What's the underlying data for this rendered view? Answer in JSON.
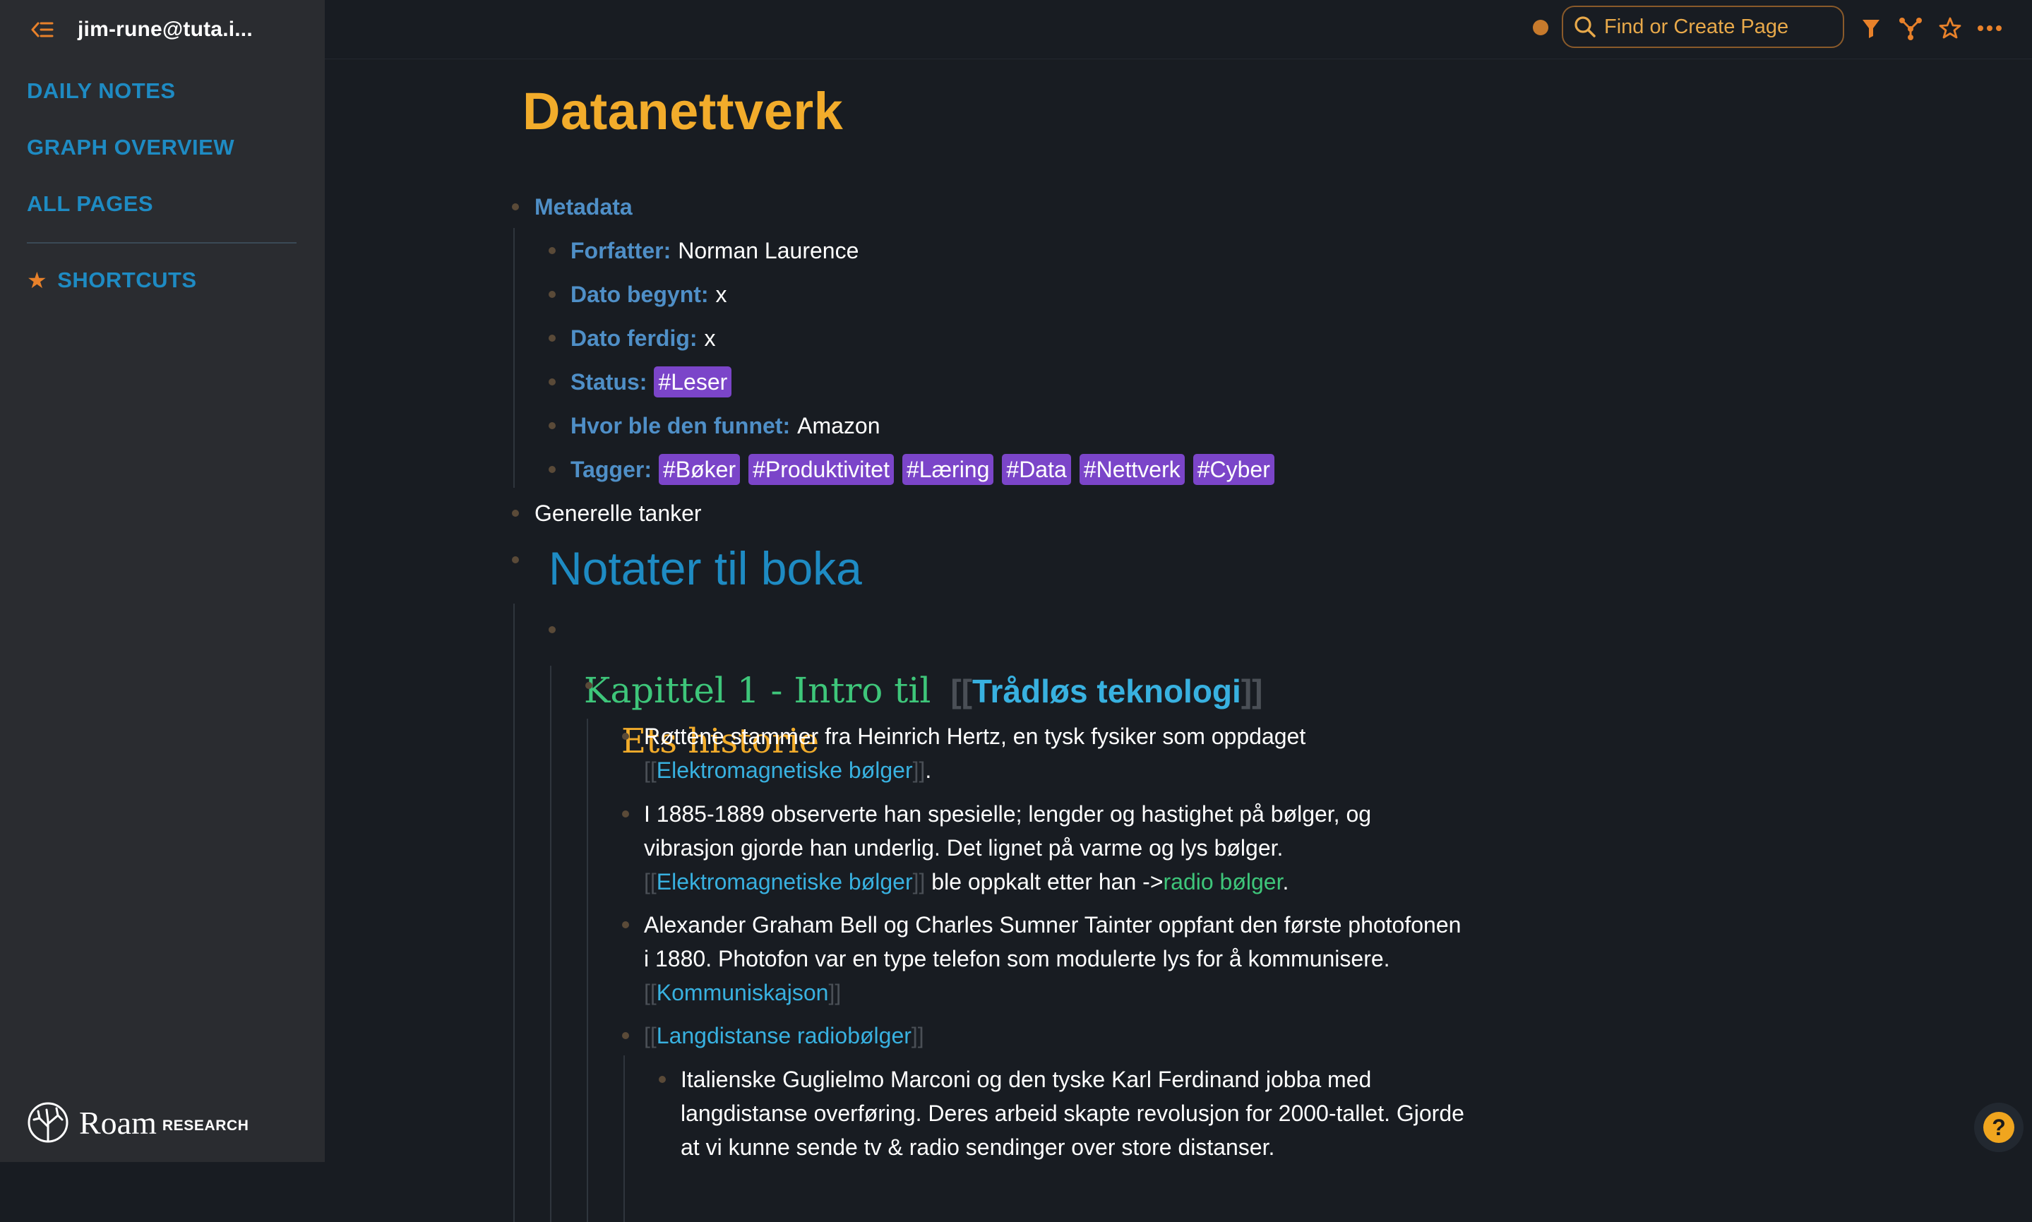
{
  "sidebar": {
    "user": "jim-rune@tuta.i...",
    "nav": [
      "DAILY NOTES",
      "GRAPH OVERVIEW",
      "ALL PAGES"
    ],
    "shortcuts_label": "SHORTCUTS",
    "logo": {
      "word": "Roam",
      "suffix": "RESEARCH"
    }
  },
  "topbar": {
    "search_placeholder": "Find or Create Page"
  },
  "page": {
    "title": "Datanettverk",
    "metadata": {
      "label": "Metadata",
      "forfatter_key": "Forfatter:",
      "forfatter_val": "Norman Laurence",
      "dato_begynt_key": "Dato begynt:",
      "dato_begynt_val": "x",
      "dato_ferdig_key": "Dato ferdig:",
      "dato_ferdig_val": "x",
      "status_key": "Status:",
      "status_tag": "#Leser",
      "funnet_key": "Hvor ble den funnet:",
      "funnet_val": "Amazon",
      "tagger_key": "Tagger:",
      "tags": [
        "#Bøker",
        "#Produktivitet",
        "#Læring",
        "#Data",
        "#Nettverk",
        "#Cyber"
      ]
    },
    "generelle": "Generelle tanker",
    "heading": "Notater til boka",
    "chapter": {
      "text": "Kapittel 1 - Intro til",
      "link": "Trådløs teknologi"
    },
    "section": "Ets historie",
    "open_bracket": "[[",
    "close_bracket": "]]",
    "p1": {
      "line1": "Røttene stammer fra Heinrich Hertz, en tysk fysiker som oppdaget",
      "link": "Elektromagnetiske bølger",
      "end": "."
    },
    "p2": {
      "line1": "I 1885-1889 observerte han spesielle; lengder og hastighet på bølger, og",
      "line2": "vibrasjon gjorde han underlig. Det lignet på varme og lys bølger.",
      "link": "Elektromagnetiske bølger",
      "mid": " ble oppkalt etter han ->",
      "link2": "radio bølger",
      "end": "."
    },
    "p3": {
      "line1": "Alexander Graham Bell og Charles Sumner Tainter oppfant den første photofonen",
      "line2": "i 1880. Photofon var en type telefon som modulerte lys for å kommunisere.",
      "link": "Kommuniskajson"
    },
    "p4": {
      "link": "Langdistanse radiobølger"
    },
    "p5": {
      "line1": "Italienske Guglielmo Marconi og den tyske Karl Ferdinand jobba med",
      "line2": "langdistanse overføring. Deres arbeid skapte revolusjon for 2000-tallet. Gjorde",
      "line3": "at vi kunne sende tv & radio sendinger over store distanser."
    }
  },
  "help": {
    "label": "?"
  }
}
